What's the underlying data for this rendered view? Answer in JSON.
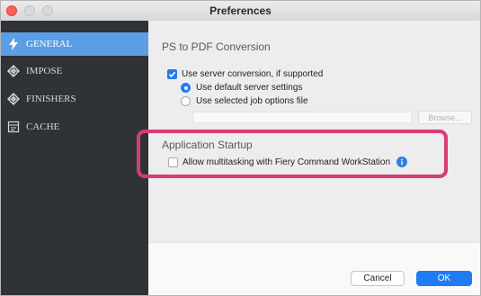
{
  "window": {
    "title": "Preferences"
  },
  "sidebar": {
    "items": [
      {
        "label": "GENERAL",
        "icon": "lightning-icon",
        "active": true
      },
      {
        "label": "IMPOSE",
        "icon": "impose-icon",
        "active": false
      },
      {
        "label": "FINISHERS",
        "icon": "finishers-icon",
        "active": false
      },
      {
        "label": "CACHE",
        "icon": "cache-icon",
        "active": false
      }
    ]
  },
  "ps_to_pdf": {
    "title": "PS to PDF Conversion",
    "use_server_conversion": {
      "label": "Use server conversion, if supported",
      "checked": true
    },
    "radio_default": {
      "label": "Use default server settings",
      "selected": true
    },
    "radio_job_options": {
      "label": "Use selected job options file",
      "selected": false
    },
    "file_path": "",
    "browse_label": "Browse..."
  },
  "app_startup": {
    "title": "Application Startup",
    "allow_multitasking": {
      "label": "Allow multitasking with Fiery Command WorkStation",
      "checked": false
    }
  },
  "footer": {
    "cancel_label": "Cancel",
    "ok_label": "OK"
  },
  "colors": {
    "accent": "#1f7cf5",
    "sidebar_bg": "#2f3236",
    "sidebar_active": "#5b9ee6",
    "highlight": "#d93a78"
  }
}
